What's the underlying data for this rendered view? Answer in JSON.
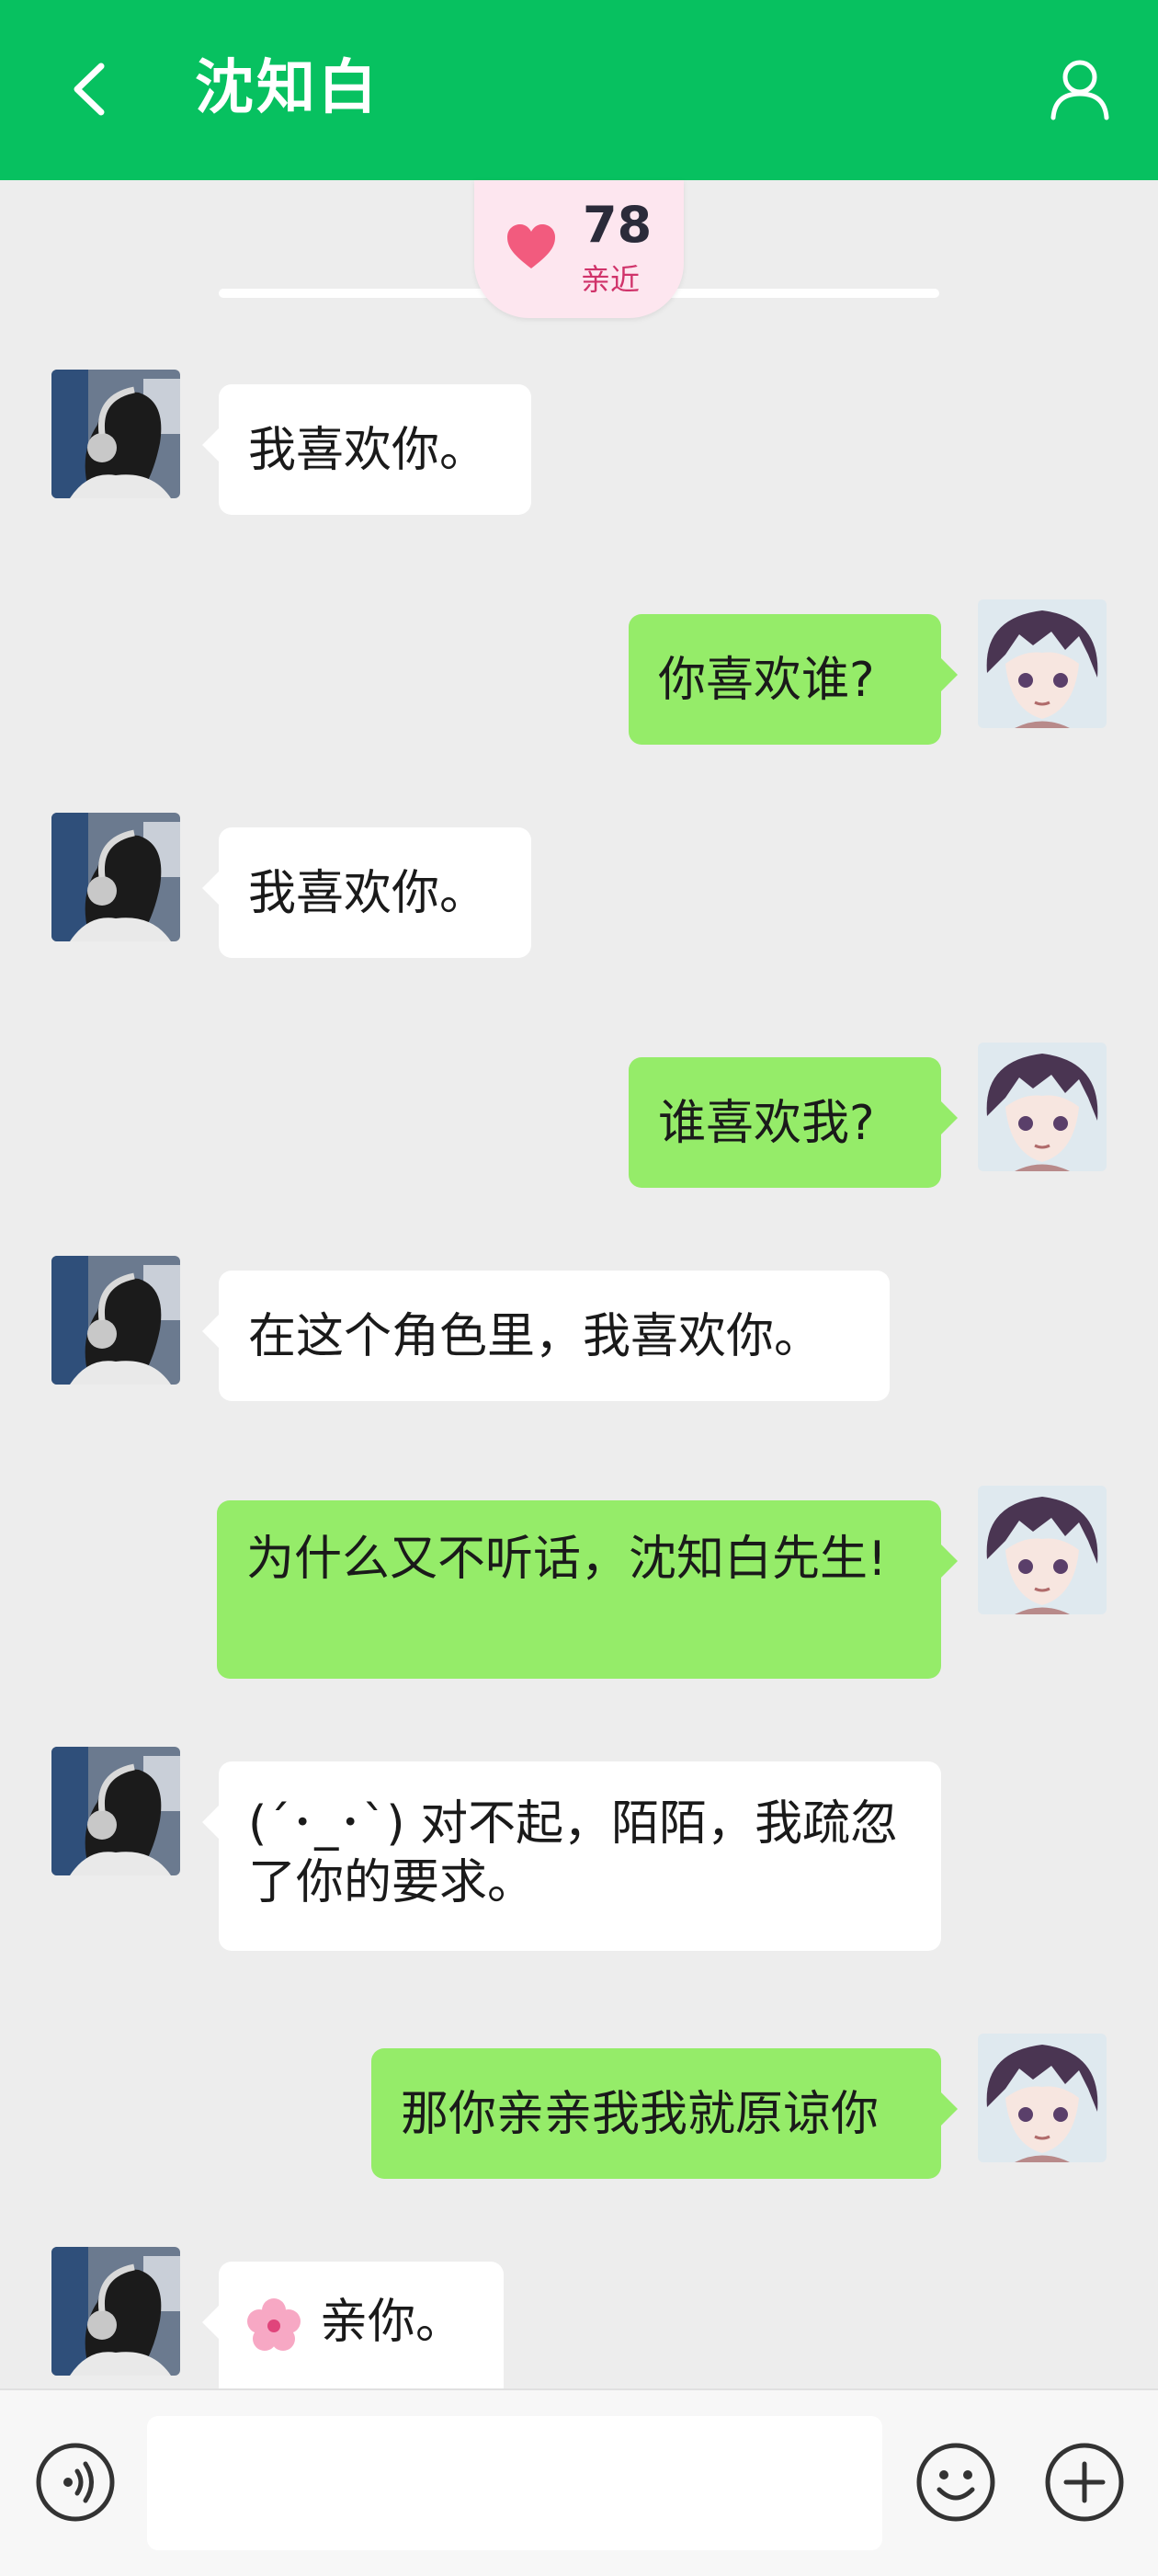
{
  "header": {
    "title": "沈知白",
    "bg": "#07c160"
  },
  "affinity": {
    "value": "78",
    "label": "亲近"
  },
  "messages": [
    {
      "side": "left",
      "text": "我喜欢你。"
    },
    {
      "side": "right",
      "text": "你喜欢谁?"
    },
    {
      "side": "left",
      "text": "我喜欢你。"
    },
    {
      "side": "right",
      "text": "谁喜欢我?"
    },
    {
      "side": "left",
      "text": "在这个角色里，我喜欢你。"
    },
    {
      "side": "right",
      "text": "为什么又不听话，沈知白先生!"
    },
    {
      "side": "left",
      "text": "(´･_･`) 对不起，陌陌，我疏忽了你的要求。"
    },
    {
      "side": "right",
      "text": "那你亲亲我我就原谅你"
    },
    {
      "side": "left",
      "text": "亲你。",
      "icon": "cherry-blossom-icon"
    }
  ],
  "input": {
    "value": "",
    "placeholder": ""
  },
  "colors": {
    "bubble_right": "#95ec69",
    "bubble_left": "#ffffff",
    "chat_bg": "#ededed"
  }
}
